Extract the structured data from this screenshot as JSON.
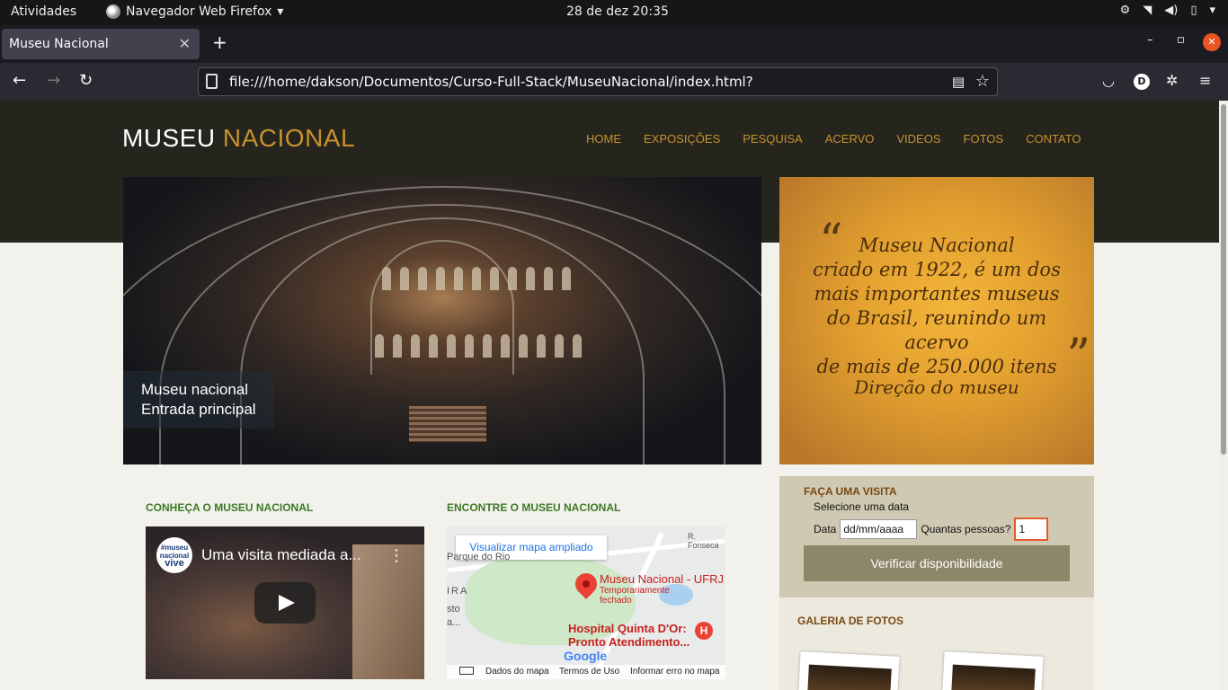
{
  "system": {
    "activities": "Atividades",
    "app_name": "Navegador Web Firefox",
    "clock": "28 de dez  20:35"
  },
  "browser": {
    "tab_title": "Museu Nacional",
    "url": "file:///home/dakson/Documentos/Curso-Full-Stack/MuseuNacional/index.html?",
    "account_initial": "D"
  },
  "site": {
    "logo_part1": "MUSEU",
    "logo_part2": "NACIONAL",
    "nav": [
      "HOME",
      "EXPOSIÇÕES",
      "PESQUISA",
      "ACERVO",
      "VIDEOS",
      "FOTOS",
      "CONTATO"
    ],
    "hero_caption_line1": "Museu nacional",
    "hero_caption_line2": "Entrada principal",
    "quote_line1": "Museu Nacional",
    "quote_line2": "criado em 1922, é um dos",
    "quote_line3": "mais importantes museus",
    "quote_line4": "do Brasil, reunindo um acervo",
    "quote_line5": "de mais de 250.000 itens",
    "quote_author": "Direção do museu",
    "visit": {
      "title": "FAÇA UMA VISITA",
      "subtitle": "Selecione uma data",
      "date_label": "Data",
      "date_placeholder": "dd/mm/aaaa",
      "qty_label": "Quantas pessoas?",
      "qty_value": "1",
      "button": "Verificar disponibilidade"
    },
    "gallery_title": "GALERIA DE FOTOS",
    "section_video_title": "CONHEÇA O MUSEU NACIONAL",
    "section_map_title": "ENCONTRE O MUSEU NACIONAL",
    "video": {
      "logo_text_1": "#museu",
      "logo_text_2": "nacional",
      "logo_text_3": "vive",
      "title": "Uma visita mediada a..."
    },
    "map": {
      "open_button": "Visualizar mapa ampliado",
      "place_name": "Museu Nacional - UFRJ",
      "place_status_1": "Temporariamente",
      "place_status_2": "fechado",
      "hospital_line1": "Hospital Quinta D'Or:",
      "hospital_line2": "Pronto Atendimento...",
      "label_parque": "Parque do Rio",
      "label_fonseca": "R. Fonseca",
      "label_ira": "IRA",
      "label_sto": "sto",
      "label_a": "a...",
      "google": "Google",
      "footer_data": "Dados do mapa",
      "footer_terms": "Termos de Uso",
      "footer_report": "Informar erro no mapa"
    }
  },
  "colors": {
    "header_bg": "#26251d",
    "accent_gold": "#c6912e",
    "section_green": "#3c7a26",
    "visit_bg": "#cfc9b3",
    "button_bg": "#8e8669"
  }
}
